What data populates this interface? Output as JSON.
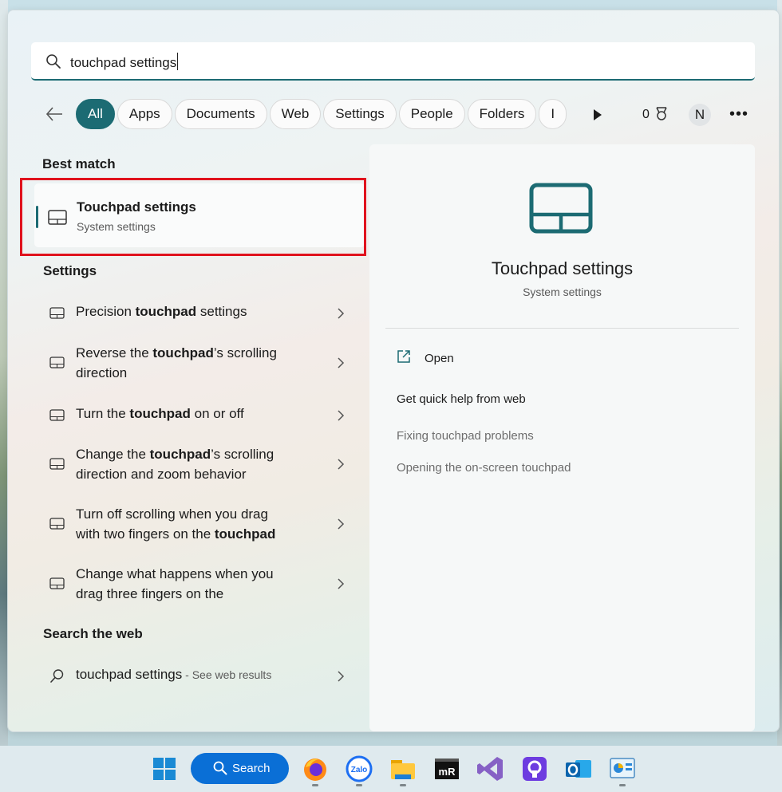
{
  "search": {
    "query": "touchpad settings"
  },
  "filters": [
    "All",
    "Apps",
    "Documents",
    "Web",
    "Settings",
    "People",
    "Folders",
    "I"
  ],
  "header": {
    "points": "0",
    "avatar_initial": "N",
    "more": "•••"
  },
  "best_match": {
    "section": "Best match",
    "title": "Touchpad settings",
    "subtitle": "System settings"
  },
  "settings": {
    "section": "Settings",
    "items": [
      {
        "pre": "Precision ",
        "bold": "touchpad",
        "post": " settings",
        "line2": ""
      },
      {
        "pre": "Reverse the ",
        "bold": "touchpad",
        "post": "’s scrolling",
        "line2": "direction"
      },
      {
        "pre": "Turn the ",
        "bold": "touchpad",
        "post": " on or off",
        "line2": ""
      },
      {
        "pre": "Change the ",
        "bold": "touchpad",
        "post": "’s scrolling",
        "line2": "direction and zoom behavior"
      },
      {
        "pre": "Turn off scrolling when you drag",
        "bold": "",
        "post": "",
        "line2_pre": "with two fingers on the ",
        "line2_bold": "touchpad"
      },
      {
        "pre": "Change what happens when you",
        "bold": "",
        "post": "",
        "line2": "drag three fingers on the"
      }
    ]
  },
  "web": {
    "section": "Search the web",
    "query": "touchpad settings",
    "suffix": " - See web results"
  },
  "details": {
    "title": "Touchpad settings",
    "subtitle": "System settings",
    "open_label": "Open",
    "help_heading": "Get quick help from web",
    "links": [
      "Fixing touchpad problems",
      "Opening the on-screen touchpad"
    ]
  },
  "taskbar": {
    "search_label": "Search",
    "icons": [
      "windows-start-icon",
      "firefox-icon",
      "zalo-icon",
      "file-explorer-icon",
      "mremoteng-icon",
      "visual-studio-icon",
      "proton-pass-icon",
      "outlook-icon",
      "control-panel-icon"
    ]
  },
  "colors": {
    "accent": "#1c6b73",
    "highlight": "#e0121d",
    "taskbar_search": "#0a6fd6"
  }
}
